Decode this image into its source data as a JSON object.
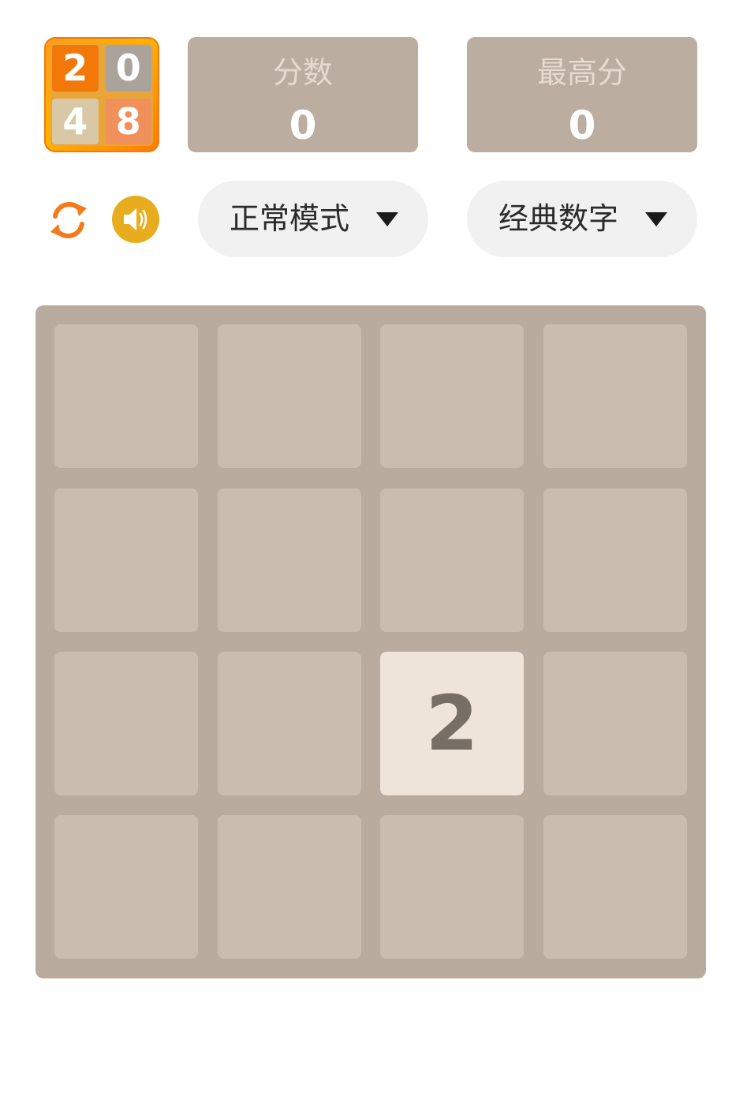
{
  "logo": {
    "tiles": [
      "2",
      "0",
      "4",
      "8"
    ]
  },
  "scores": {
    "current_label": "分数",
    "current_value": "0",
    "best_label": "最高分",
    "best_value": "0"
  },
  "controls": {
    "restart_icon": "refresh-icon",
    "sound_icon": "speaker-icon",
    "mode_select": "正常模式",
    "number_select": "经典数字"
  },
  "board": {
    "size": 4,
    "grid": [
      [
        "",
        "",
        "",
        ""
      ],
      [
        "",
        "",
        "",
        ""
      ],
      [
        "",
        "",
        "2",
        ""
      ],
      [
        "",
        "",
        "",
        ""
      ]
    ]
  },
  "colors": {
    "board": "#b9ac9f",
    "empty_cell": "#cabdb0",
    "tile_2_bg": "#eee4da",
    "tile_2_text": "#776e65",
    "score_box": "#bbad9f",
    "accent_orange": "#f2780a",
    "sound_button": "#e8ad1e"
  }
}
